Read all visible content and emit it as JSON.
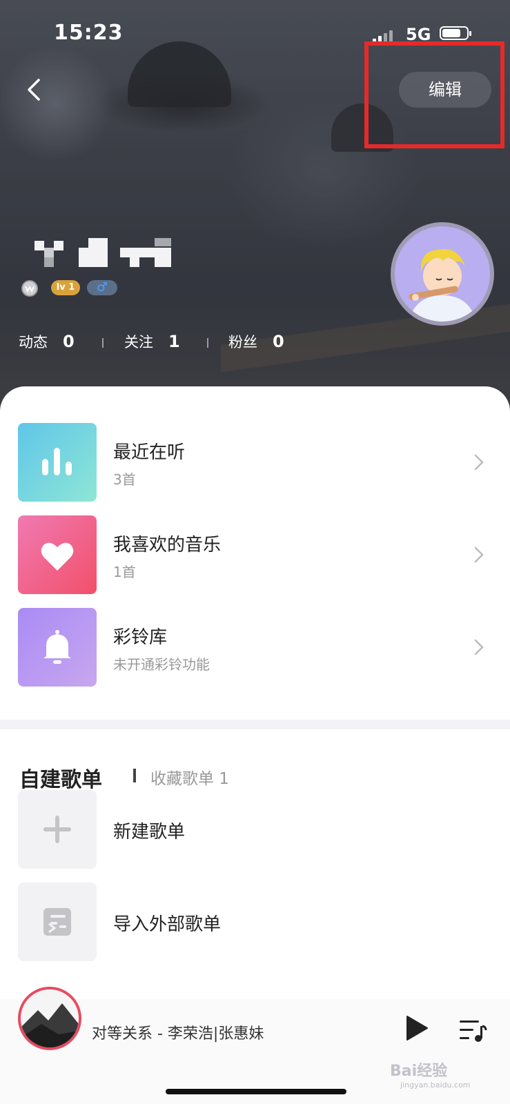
{
  "status_bar": {
    "time": "15:23",
    "network": "5G"
  },
  "header": {
    "edit_label": "编辑"
  },
  "profile": {
    "level_badge": "lv 1",
    "gender_symbol": "♂",
    "stats": [
      {
        "label": "动态",
        "value": "0"
      },
      {
        "label": "关注",
        "value": "1"
      },
      {
        "label": "粉丝",
        "value": "0"
      }
    ]
  },
  "music_list": [
    {
      "title": "最近在听",
      "subtitle": "3首",
      "icon": "bar-chart-icon"
    },
    {
      "title": "我喜欢的音乐",
      "subtitle": "1首",
      "icon": "heart-icon"
    },
    {
      "title": "彩铃库",
      "subtitle": "未开通彩铃功能",
      "icon": "bell-icon"
    }
  ],
  "playlists": {
    "tab_created": "自建歌单",
    "tab_favorites": "收藏歌单 1",
    "items": [
      {
        "label": "新建歌单",
        "icon": "plus-icon"
      },
      {
        "label": "导入外部歌单",
        "icon": "import-icon"
      }
    ]
  },
  "player": {
    "now_playing": "对等关系 - 李荣浩|张惠妹"
  },
  "watermark": {
    "text": "Bai经验",
    "sub": "jingyan.baidu.com"
  },
  "colors": {
    "highlight_box": "#e52a2a",
    "disc_ring": "#e84a5f"
  }
}
